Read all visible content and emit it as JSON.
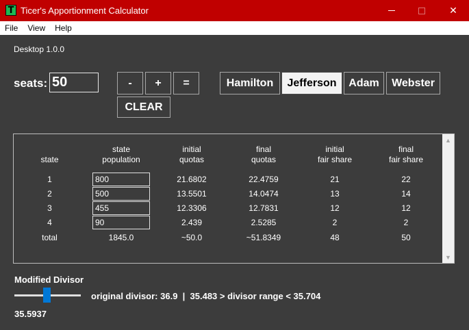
{
  "window": {
    "title": "Ticer's Apportionment Calculator",
    "icon_letter": "T",
    "close_glyph": "✕"
  },
  "menu": [
    "File",
    "View",
    "Help"
  ],
  "version": "Desktop 1.0.0",
  "seats": {
    "label": "seats:",
    "value": "50"
  },
  "buttons": {
    "minus": "-",
    "plus": "+",
    "equals": "=",
    "clear": "CLEAR"
  },
  "methods": {
    "items": [
      "Hamilton",
      "Jefferson",
      "Adam",
      "Webster"
    ],
    "selected": "Jefferson"
  },
  "table": {
    "headers": [
      [
        "",
        "state"
      ],
      [
        "state",
        "population"
      ],
      [
        "initial",
        "quotas"
      ],
      [
        "final",
        "quotas"
      ],
      [
        "initial",
        "fair share"
      ],
      [
        "final",
        "fair share"
      ]
    ],
    "rows": [
      {
        "state": "1",
        "population": "800",
        "initial_quota": "21.6802",
        "final_quota": "22.4759",
        "initial_fair_share": "21",
        "final_fair_share": "22"
      },
      {
        "state": "2",
        "population": "500",
        "initial_quota": "13.5501",
        "final_quota": "14.0474",
        "initial_fair_share": "13",
        "final_fair_share": "14"
      },
      {
        "state": "3",
        "population": "455",
        "initial_quota": "12.3306",
        "final_quota": "12.7831",
        "initial_fair_share": "12",
        "final_fair_share": "12"
      },
      {
        "state": "4",
        "population": "90",
        "initial_quota": "2.439",
        "final_quota": "2.5285",
        "initial_fair_share": "2",
        "final_fair_share": "2"
      }
    ],
    "total": {
      "label": "total",
      "population": "1845.0",
      "initial_quota": "~50.0",
      "final_quota": "~51.8349",
      "initial_fair_share": "48",
      "final_fair_share": "50"
    }
  },
  "divisor": {
    "label": "Modified Divisor",
    "info": "original divisor: 36.9  |  35.483 > divisor range < 35.704",
    "value": "35.5937"
  },
  "colors": {
    "titlebar": "#c00000",
    "background": "#3c3c3c",
    "slider_thumb": "#0078d7",
    "app_icon": "#1db954"
  }
}
